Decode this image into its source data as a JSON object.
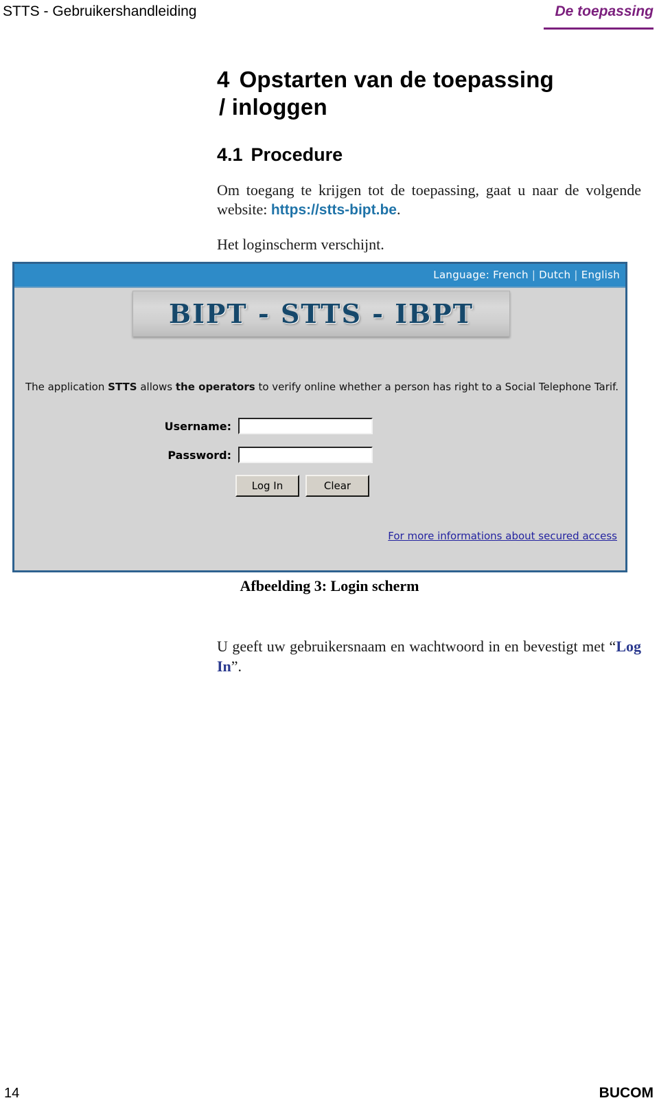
{
  "header": {
    "left_title": "STTS - Gebruikershandleiding",
    "right_title": "De toepassing",
    "accent_color": "#7B1F7D"
  },
  "heading": {
    "number": "4",
    "line1": "Opstarten van de toepassing",
    "line2": "/ inloggen"
  },
  "subheading": {
    "number": "4.1",
    "text": "Procedure"
  },
  "paragraphs": {
    "intro_part1": "Om toegang te krijgen tot de toepassing, gaat u naar de volgende website: ",
    "intro_url": "https://stts-bipt.be",
    "intro_part2": ".",
    "intro_line2": "Het loginscherm verschijnt.",
    "after_part1": "U geeft uw gebruikersnaam en wachtwoord in en bevestigt met “",
    "after_link": "Log In",
    "after_part2": "”."
  },
  "screenshot": {
    "language_label": "Language:",
    "languages": [
      "French",
      "Dutch",
      "English"
    ],
    "separator": "|",
    "logo_text": "BIPT - STTS - IBPT",
    "description_pre": "The application ",
    "description_bold1": "STTS",
    "description_mid": " allows ",
    "description_bold2": "the operators",
    "description_post": " to verify online whether a person has right to a Social Telephone Tarif.",
    "username_label": "Username:",
    "username_value": "",
    "password_label": "Password:",
    "password_value": "",
    "login_button": "Log In",
    "clear_button": "Clear",
    "secured_link": "For more informations about secured access",
    "bar_color": "#2E8BC8",
    "border_color": "#2E628F",
    "body_color": "#D4D4D4",
    "link_color": "#2323A0"
  },
  "figure": {
    "caption": "Afbeelding 3: Login scherm"
  },
  "footer": {
    "page_number": "14",
    "brand": "BUCOM"
  }
}
